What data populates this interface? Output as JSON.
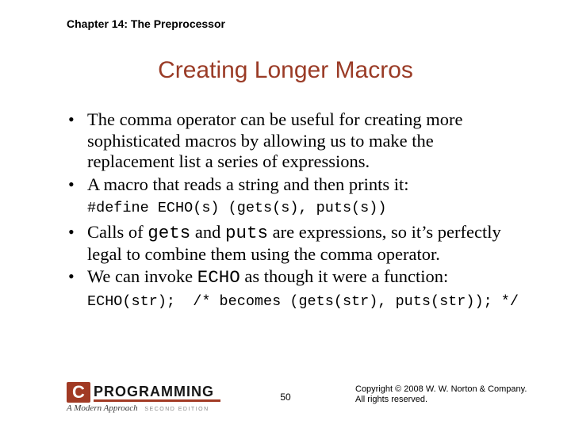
{
  "chapter": "Chapter 14: The Preprocessor",
  "title": "Creating Longer Macros",
  "bullets": {
    "b1": "The comma operator can be useful for creating more sophisticated macros by allowing us to make the replacement list a series of expressions.",
    "b2": "A macro that reads a string and then prints it:",
    "b3_pre": "Calls of ",
    "b3_code1": "gets",
    "b3_mid1": " and ",
    "b3_code2": "puts",
    "b3_mid2": " are expressions, so it’s perfectly legal to combine them using the comma operator.",
    "b4_pre": "We can invoke ",
    "b4_code": "ECHO",
    "b4_post": " as though it were a function:"
  },
  "code": {
    "define": "#define ECHO(s) (gets(s), puts(s))",
    "invoke": "ECHO(str);  /* becomes (gets(str), puts(str)); */"
  },
  "footer": {
    "logo_c": "C",
    "logo_prog": "PROGRAMMING",
    "logo_sub": "A Modern Approach",
    "logo_ed": "SECOND EDITION",
    "page": "50",
    "copyright_l1": "Copyright © 2008 W. W. Norton & Company.",
    "copyright_l2": "All rights reserved."
  }
}
